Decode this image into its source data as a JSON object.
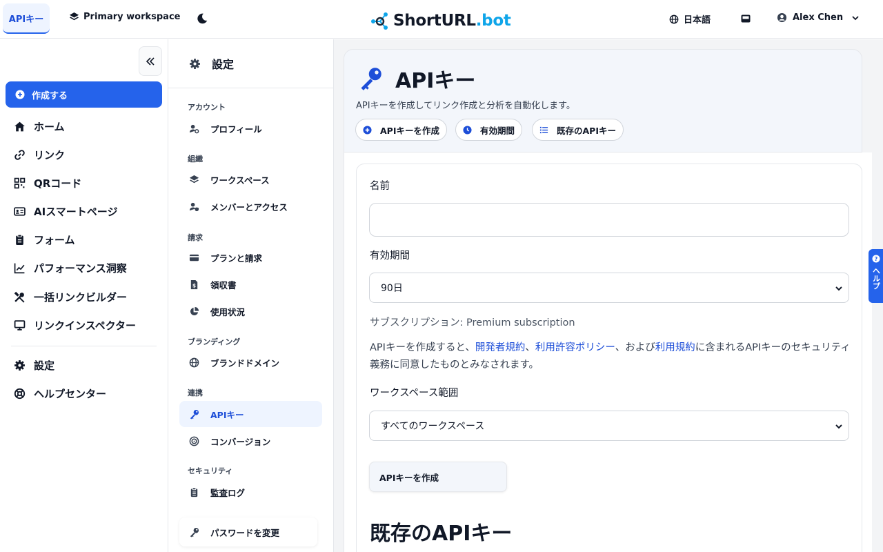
{
  "topbar": {
    "active_tab": "APIキー",
    "workspace": "Primary workspace",
    "logo_main": "ShortURL",
    "logo_suffix": ".bot",
    "language": "日本語",
    "user_name": "Alex Chen"
  },
  "sidebar": {
    "create_label": "作成する",
    "items": [
      {
        "label": "ホーム",
        "icon": "home-icon"
      },
      {
        "label": "リンク",
        "icon": "link-icon"
      },
      {
        "label": "QRコード",
        "icon": "qr-icon"
      },
      {
        "label": "AIスマートページ",
        "icon": "id-card-icon"
      },
      {
        "label": "フォーム",
        "icon": "clipboard-icon"
      },
      {
        "label": "パフォーマンス洞察",
        "icon": "chart-line-icon"
      },
      {
        "label": "一括リンクビルダー",
        "icon": "tools-icon"
      },
      {
        "label": "リンクインスペクター",
        "icon": "monitor-icon"
      }
    ],
    "bottom_items": [
      {
        "label": "設定",
        "icon": "gear-icon"
      },
      {
        "label": "ヘルプセンター",
        "icon": "lifebuoy-icon"
      }
    ]
  },
  "settings_nav": {
    "title": "設定",
    "sections": {
      "account": "アカウント",
      "org": "組織",
      "billing": "請求",
      "branding": "ブランディング",
      "integrations": "連携",
      "security": "セキュリティ"
    },
    "items": {
      "profile": "プロフィール",
      "workspace": "ワークスペース",
      "members": "メンバーとアクセス",
      "plans": "プランと請求",
      "receipts": "領収書",
      "usage": "使用状況",
      "brand_domain": "ブランドドメイン",
      "api_keys": "APIキー",
      "conversions": "コンバージョン",
      "audit_log": "監査ログ",
      "change_password": "パスワードを変更"
    }
  },
  "main": {
    "title": "APIキー",
    "subtitle": "APIキーを作成してリンク作成と分析を自動化します。",
    "pills": [
      "APIキーを作成",
      "有効期間",
      "既存のAPIキー"
    ],
    "form": {
      "name_label": "名前",
      "name_value": "",
      "expiry_label": "有効期間",
      "expiry_value": "90日",
      "subscription_text": "サブスクリプション: Premium subscription",
      "legal_pre": "APIキーを作成すると、",
      "legal_link1": "開発者規約",
      "legal_sep1": "、",
      "legal_link2": "利用許容ポリシー",
      "legal_mid": "、および",
      "legal_link3": "利用規約",
      "legal_post": "に含まれるAPIキーのセキュリティ義務に同意したものとみなされます。",
      "scope_label": "ワークスペース範囲",
      "scope_value": "すべてのワークスペース",
      "submit_label": "APIキーを作成"
    },
    "existing_title": "既存のAPIキー"
  },
  "help_tab": "ヘルプ",
  "colors": {
    "accent": "#2563eb",
    "logo_bot": "#0ea5e9"
  }
}
